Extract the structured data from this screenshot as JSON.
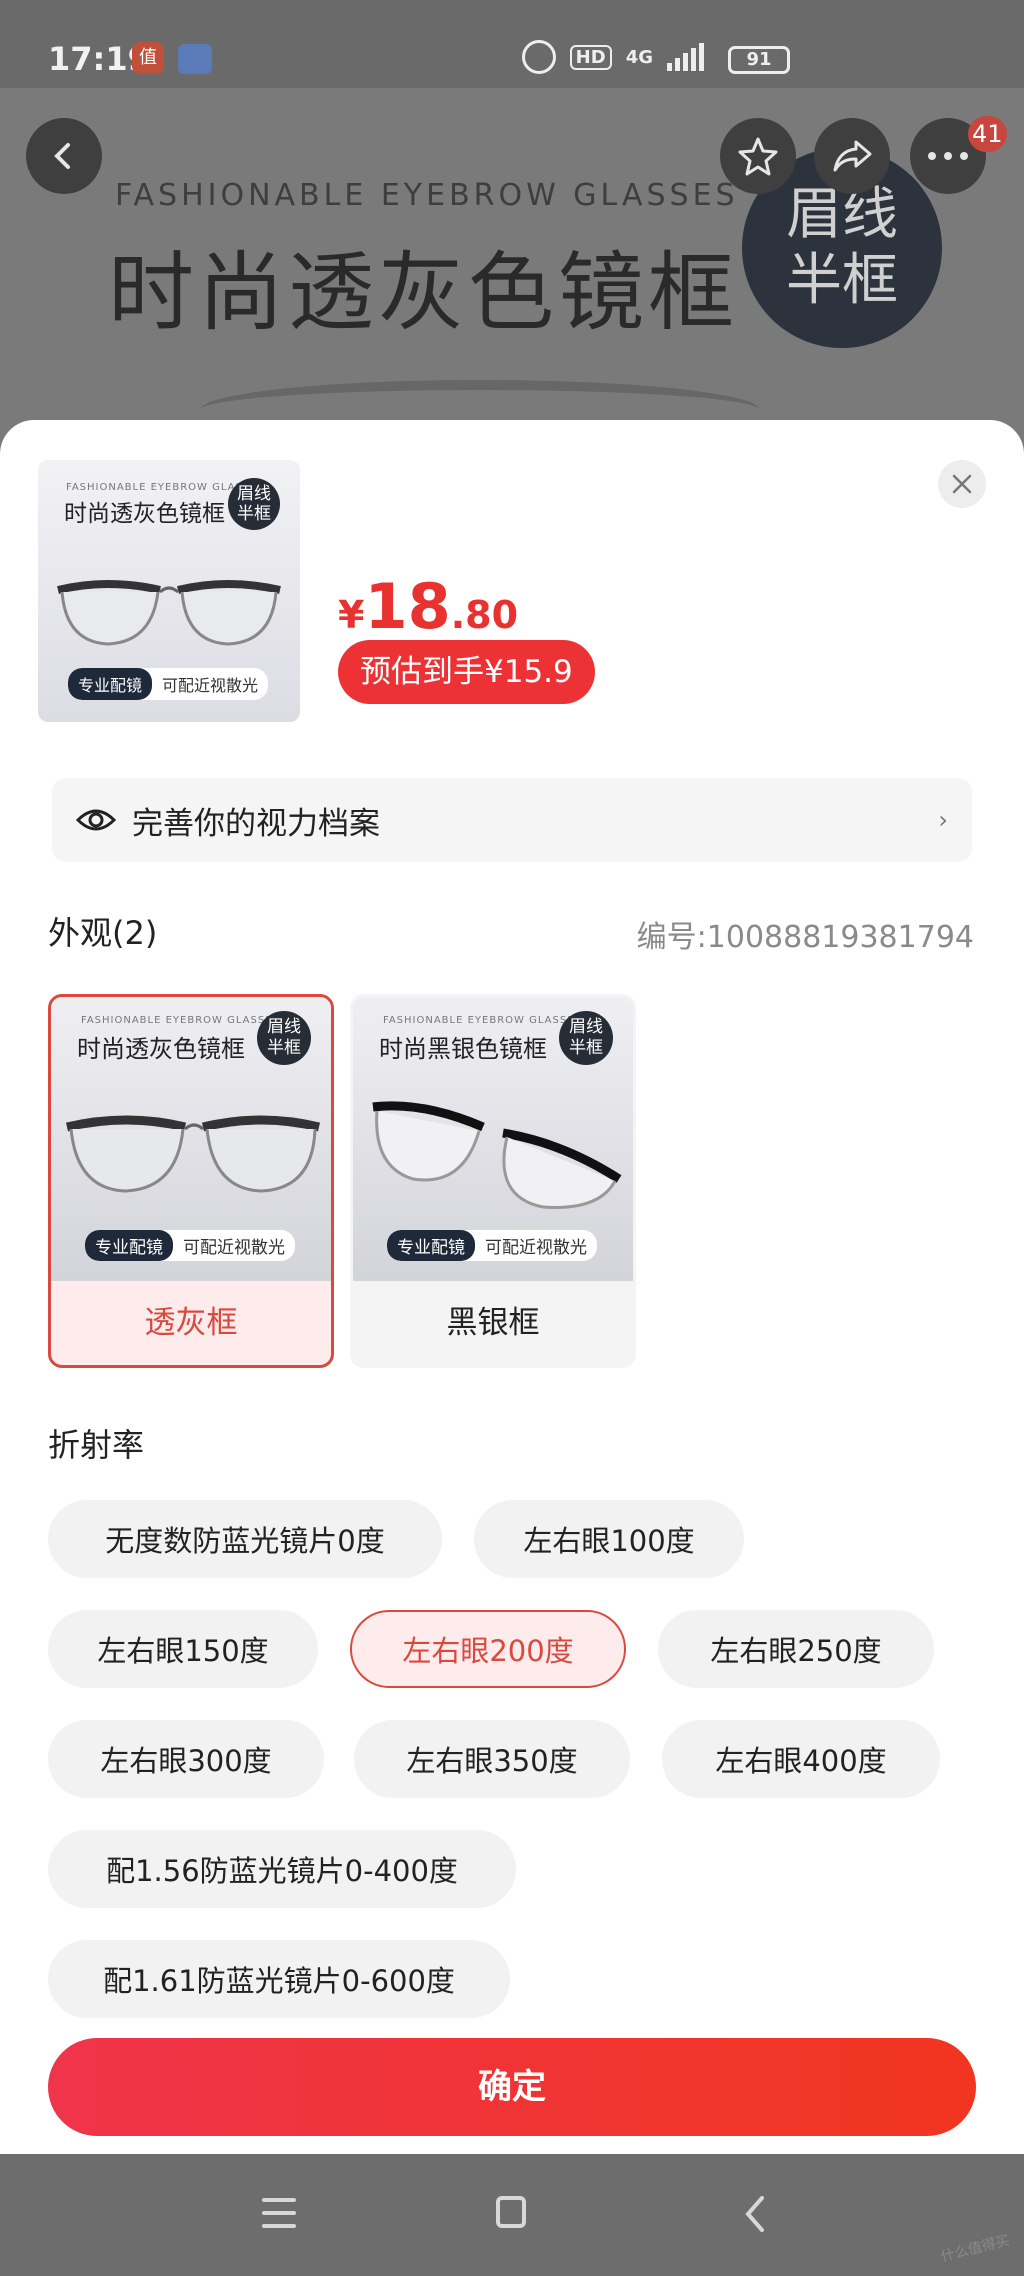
{
  "status_bar": {
    "time": "17:19",
    "network": "4G",
    "hd": "HD",
    "battery": "91"
  },
  "hero": {
    "subtitle": "FASHIONABLE EYEBROW GLASSES",
    "title": "时尚透灰色镜框",
    "badge": "眉线半框",
    "cart_count": "41"
  },
  "product": {
    "thumb_subtitle": "FASHIONABLE EYEBROW GLASSES",
    "thumb_title": "时尚透灰色镜框",
    "thumb_badge": "眉线半框",
    "thumb_tag_primary": "专业配镜",
    "thumb_tag_secondary": "可配近视散光",
    "currency": "¥",
    "price_int": "18",
    "price_dec": ".80",
    "estimate": "预估到手¥15.9",
    "accent_color": "#e8322f"
  },
  "vision_profile": {
    "label": "完善你的视力档案",
    "chevron": "›"
  },
  "appearance": {
    "title": "外观(2)",
    "code": "编号:10088819381794",
    "options": [
      {
        "sub": "FASHIONABLE EYEBROW GLASSES",
        "title": "时尚透灰色镜框",
        "badge": "眉线半框",
        "tag_primary": "专业配镜",
        "tag_secondary": "可配近视散光",
        "label": "透灰框",
        "selected": true
      },
      {
        "sub": "FASHIONABLE EYEBROW GLASSES",
        "title": "时尚黑银色镜框",
        "badge": "眉线半框",
        "tag_primary": "专业配镜",
        "tag_secondary": "可配近视散光",
        "label": "黑银框",
        "selected": false
      }
    ]
  },
  "refraction": {
    "title": "折射率",
    "options": [
      {
        "label": "无度数防蓝光镜片0度",
        "selected": false
      },
      {
        "label": "左右眼100度",
        "selected": false
      },
      {
        "label": "左右眼150度",
        "selected": false
      },
      {
        "label": "左右眼200度",
        "selected": true
      },
      {
        "label": "左右眼250度",
        "selected": false
      },
      {
        "label": "左右眼300度",
        "selected": false
      },
      {
        "label": "左右眼350度",
        "selected": false
      },
      {
        "label": "左右眼400度",
        "selected": false
      },
      {
        "label": "配1.56防蓝光镜片0-400度",
        "selected": false
      },
      {
        "label": "配1.61防蓝光镜片0-600度",
        "selected": false
      }
    ]
  },
  "confirm_label": "确定",
  "watermark": "什么值得买"
}
